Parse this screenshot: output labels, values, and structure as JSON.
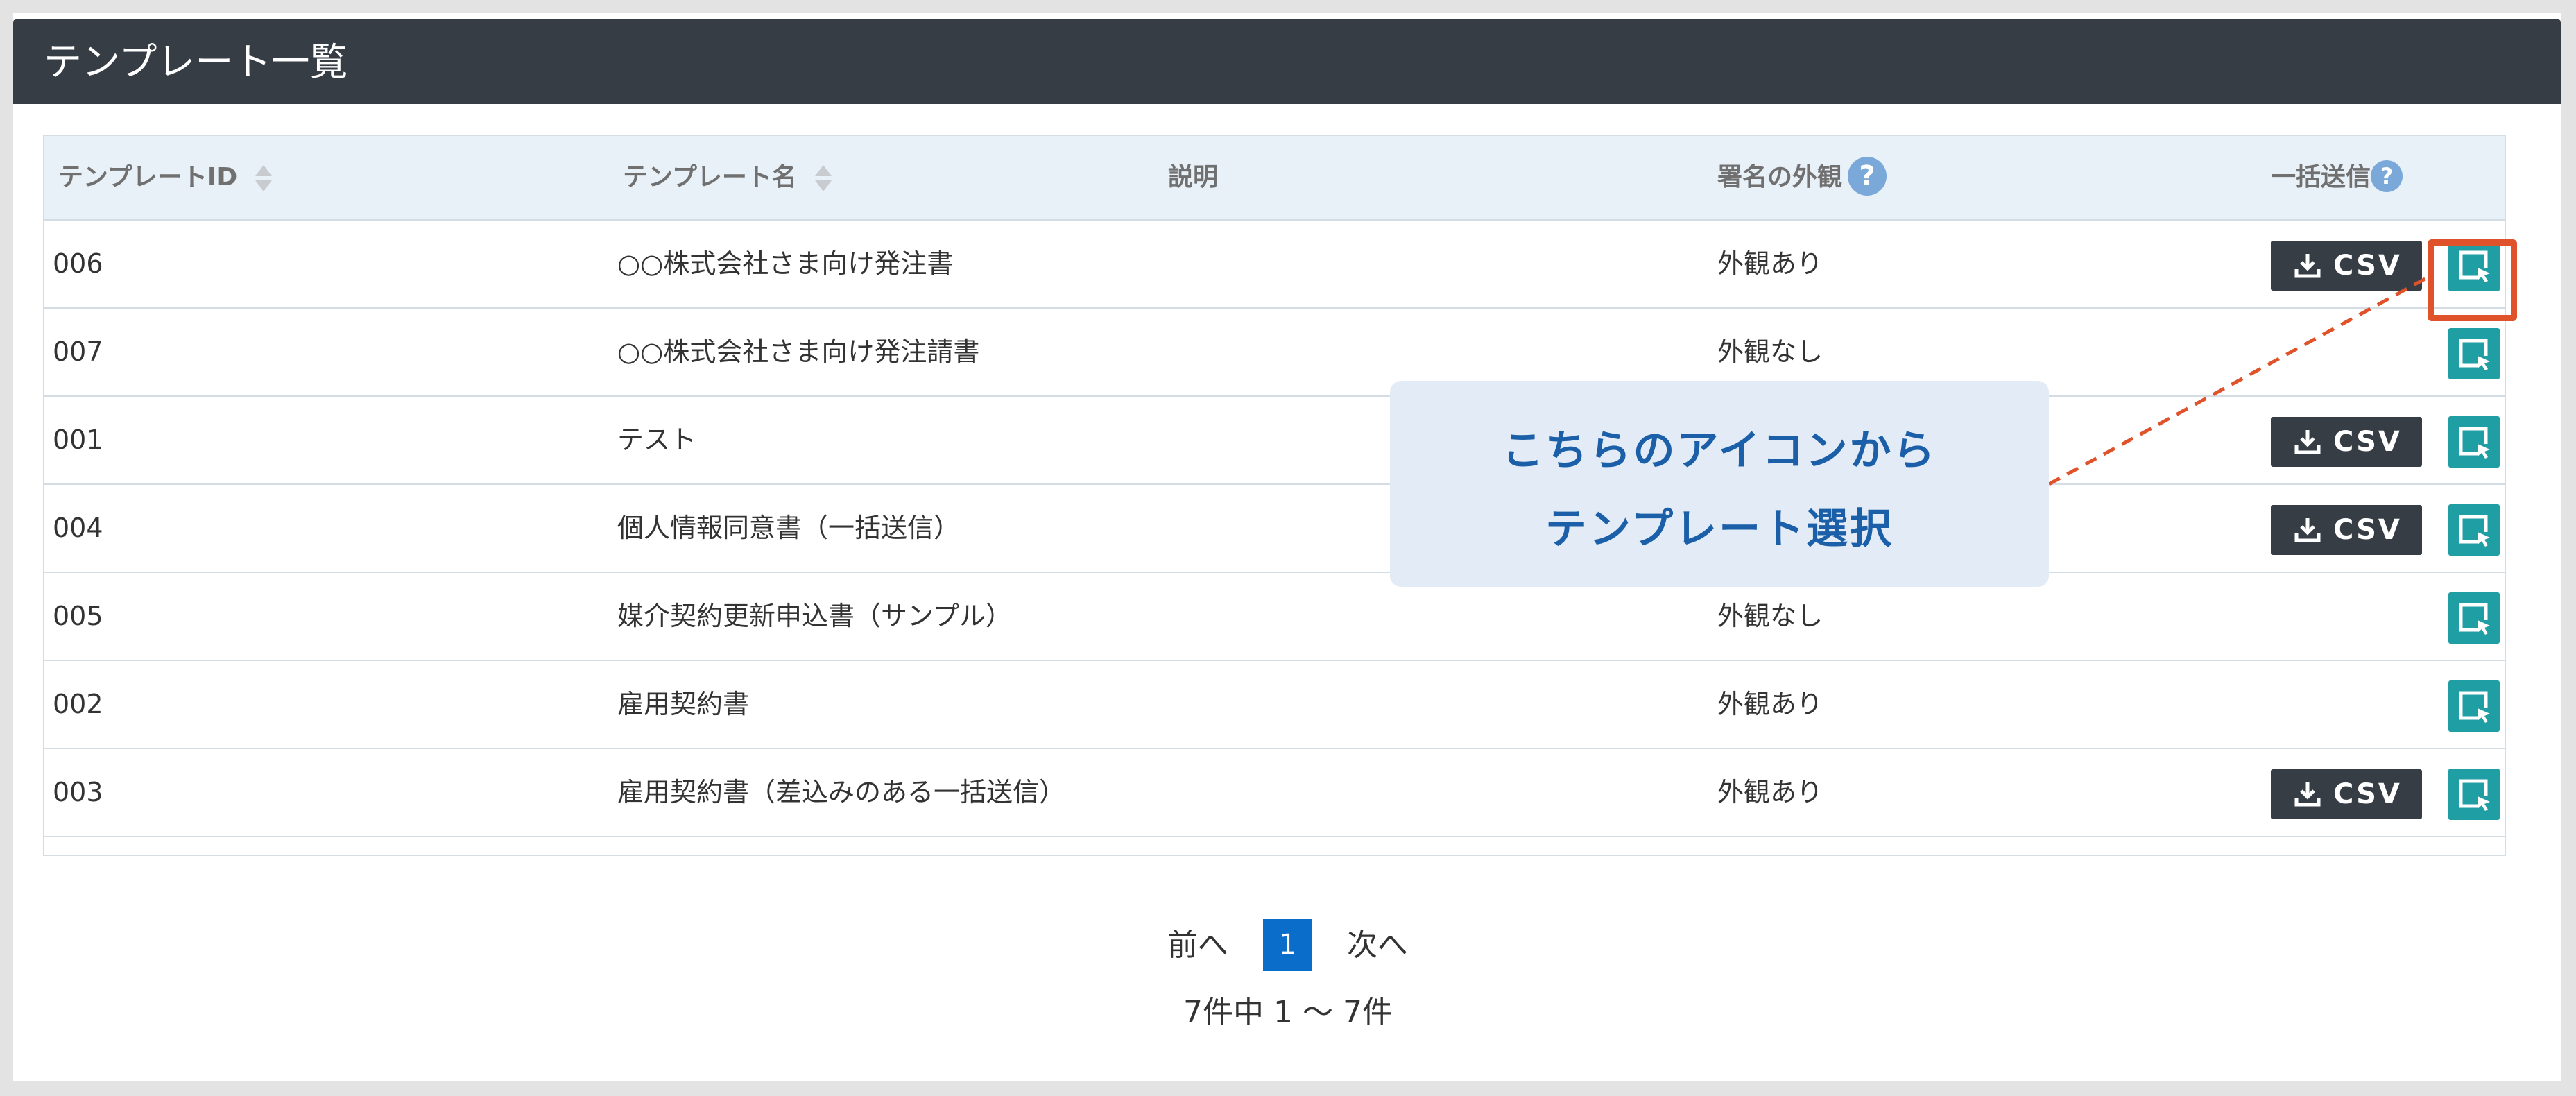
{
  "panel": {
    "title": "テンプレート一覧"
  },
  "table": {
    "headers": {
      "template_id": "テンプレートID",
      "template_name": "テンプレート名",
      "description": "説明",
      "signature_appearance": "署名の外観",
      "bulk_send": "一括送信"
    },
    "help_icon_glyph": "?",
    "rows": [
      {
        "id": "006",
        "name": "○○株式会社さま向け発注書",
        "description": "",
        "appearance": "外観あり",
        "has_csv": true
      },
      {
        "id": "007",
        "name": "○○株式会社さま向け発注請書",
        "description": "",
        "appearance": "外観なし",
        "has_csv": false
      },
      {
        "id": "001",
        "name": "テスト",
        "description": "",
        "appearance": "",
        "has_csv": true
      },
      {
        "id": "004",
        "name": "個人情報同意書（一括送信）",
        "description": "",
        "appearance": "",
        "has_csv": true
      },
      {
        "id": "005",
        "name": "媒介契約更新申込書（サンプル）",
        "description": "",
        "appearance": "外観なし",
        "has_csv": false
      },
      {
        "id": "002",
        "name": "雇用契約書",
        "description": "",
        "appearance": "外観あり",
        "has_csv": false
      },
      {
        "id": "003",
        "name": "雇用契約書（差込みのある一括送信）",
        "description": "",
        "appearance": "外観あり",
        "has_csv": true
      }
    ],
    "csv_label": "CSV"
  },
  "callout": {
    "line1": "こちらのアイコンから",
    "line2": "テンプレート選択"
  },
  "pagination": {
    "prev": "前へ",
    "current": "1",
    "next": "次へ",
    "summary": "7件中 1 〜 7件"
  },
  "icons": {
    "sort": "sort-icon",
    "help": "help-icon",
    "download": "download-icon",
    "select_template": "select-template-icon"
  },
  "colors": {
    "header_bar": "#363d45",
    "table_header_bg": "#e8f0f8",
    "csv_button": "#363d45",
    "select_button": "#1f9fa4",
    "highlight": "#e0522a",
    "callout_bg": "#e3ecf6",
    "callout_text": "#1a5fa8",
    "help_icon": "#7aa8d8",
    "page_active": "#0a6dc9"
  }
}
